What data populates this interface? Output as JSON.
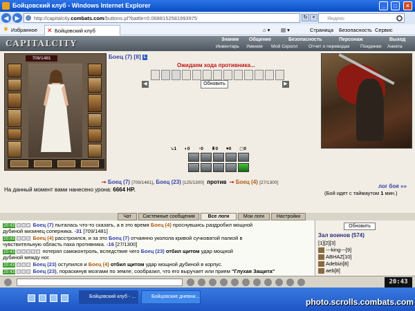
{
  "window": {
    "title": "Бойцовский клуб - Windows Internet Explorer"
  },
  "address": {
    "url_prefix": "http://capitalcity.",
    "url_domain": "combats.com",
    "url_rest": "/buttons.pl?battle=0.0688152581993975",
    "search_placeholder": "Яндекс"
  },
  "favorites": {
    "label": "Избранное",
    "tab_title": "Бойцовский клуб"
  },
  "commands": {
    "page": "Страница",
    "safety": "Безопасность",
    "service": "Сервис"
  },
  "game_menu": {
    "top": [
      "Знания",
      "Общение",
      "Безопасность",
      "Персонаж",
      "Выход"
    ],
    "sub": [
      "Инвентарь",
      "Умения",
      "Мой Скролл",
      "Отчет о переводах",
      "Поединки",
      "Анкета"
    ]
  },
  "logo": "CAPITALCITY",
  "player": {
    "hp": "709/1481"
  },
  "enemy": {
    "name": "Боец (7)",
    "level": "[8]",
    "badge": "L"
  },
  "battle": {
    "waiting": "Ожидаем хода противника...",
    "refresh": "Обновить",
    "counters": [
      "1",
      "0",
      "0",
      "0",
      "0",
      "0"
    ],
    "p1_name": "Боец (7)",
    "p1_hp": "[709/1481]",
    "p2_name": "Боец (23)",
    "p2_hp": "[125/1300]",
    "vs": "против",
    "p3_name": "Боец (4)",
    "p3_hp": "[27/1300]",
    "damage_label": "На данный момент вами нанесено урона:",
    "damage_value": "6664 HP.",
    "log_link": "лог боя »»",
    "timeout_prefix": "(Бой идет с таймаутом",
    "timeout_value": "1",
    "timeout_suffix": "мин.)"
  },
  "log_tabs": [
    "Чат",
    "Системные сообщения",
    "Все логи",
    "Мои логи",
    "Настройки"
  ],
  "log": [
    {
      "time": "20:43",
      "name1": "Боец (7)",
      "t1": " пыталась что-то сказать, а в это время ",
      "name2": "Боец (4)",
      "t2": " проснувшись раздробил мощной"
    },
    {
      "cont": "дубиной мизинец соперника. ",
      "dmg": "-31",
      "hp": " [709/1481]"
    },
    {
      "time": "20:43",
      "name1": "Боец (4)",
      "t1": " расстроился, и за это ",
      "name2": "Боец (7)",
      "t2": " отчаянно уколола кривой сучковатой палкой в"
    },
    {
      "cont": "чувствительную область паха противника. ",
      "dmg": "-16",
      "hp": " [27/1300]"
    },
    {
      "time": "20:43",
      "t0": "потерял самоконтроль, вследствие чего ",
      "name1": "Боец (23)",
      "bold": " отбил щитом",
      "t1": " удар мощной"
    },
    {
      "cont": "дубиной между ног."
    },
    {
      "time": "20:43",
      "name1": "Боец (23)",
      "t1": " оступился и ",
      "name2": "Боец (4)",
      "bold": " отбил щитом",
      "t2": " удар мощной дубиной в корпус."
    },
    {
      "time": "20:43",
      "name1": "Боец (23)",
      "t1": ", пораскинув мозгами по земле, сообразил, что его выручает или прием ",
      "bold": "\"Глухая Защита\""
    }
  ],
  "warriors": {
    "button": "Обновить",
    "title": "Зал воинов (574)",
    "pages": "[1][2][3]",
    "items": [
      "---king---[9]",
      "ABHAZ[10]",
      "Adebizi[8]",
      "aeb[8]"
    ]
  },
  "chat": {
    "clock": "20:43"
  },
  "taskbar": {
    "tasks": [
      "Бойцовский клуб - ...",
      "Бойцовские дневни..."
    ]
  },
  "watermark": "photo.scrolls.combats.com"
}
